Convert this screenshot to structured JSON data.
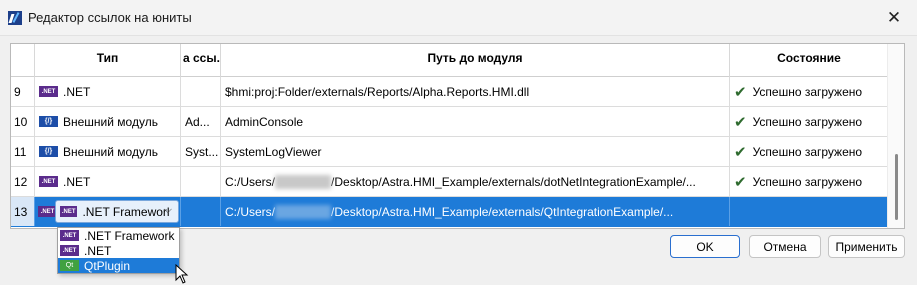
{
  "window": {
    "title": "Редактор ссылок на юниты",
    "close_glyph": "✕"
  },
  "grid": {
    "headers": {
      "num": "",
      "type": "Тип",
      "ref": "а ссы.",
      "path": "Путь до модуля",
      "state": "Состояние"
    },
    "partial_row": {
      "type": "·",
      "ref": ""
    },
    "rows": [
      {
        "num": "9",
        "badge": ".NET",
        "type": ".NET",
        "ref": "",
        "path": "$hmi:proj:Folder/externals/Reports/Alpha.Reports.HMI.dll",
        "state": "Успешно загружено"
      },
      {
        "num": "10",
        "badge": "{/}",
        "type": "Внешний модуль",
        "ref": "Ad...",
        "path": "AdminConsole",
        "state": "Успешно загружено"
      },
      {
        "num": "11",
        "badge": "{/}",
        "type": "Внешний модуль",
        "ref": "Syst...",
        "path": "SystemLogViewer",
        "state": "Успешно загружено"
      },
      {
        "num": "12",
        "badge": ".NET",
        "type": ".NET",
        "ref": "",
        "path_prefix": "C:/Users/",
        "path_suffix": "/Desktop/Astra.HMI_Example/externals/dotNetIntegrationExample/...",
        "state": "Успешно загружено"
      }
    ],
    "selected_row": {
      "num": "13",
      "badge": ".NET",
      "combo_badge": ".NET",
      "combo_value": ".NET Frameworl",
      "combo_arrow": "⌵",
      "path_prefix": "C:/Users/",
      "path_suffix": "/Desktop/Astra.HMI_Example/externals/QtIntegrationExample/...",
      "state": ""
    }
  },
  "dropdown": {
    "options": [
      {
        "badge": ".NET",
        "label": ".NET Framework"
      },
      {
        "badge": ".NET",
        "label": ".NET"
      },
      {
        "badge": "Qt",
        "label": "QtPlugin"
      }
    ]
  },
  "buttons": {
    "ok": "OK",
    "cancel": "Отмена",
    "apply": "Применить"
  },
  "colors": {
    "selection": "#1e7bd8",
    "net_badge": "#5b2c8c",
    "ext_badge": "#1d4ea8",
    "qt_badge": "#41a141",
    "check": "#2f6b2f"
  }
}
